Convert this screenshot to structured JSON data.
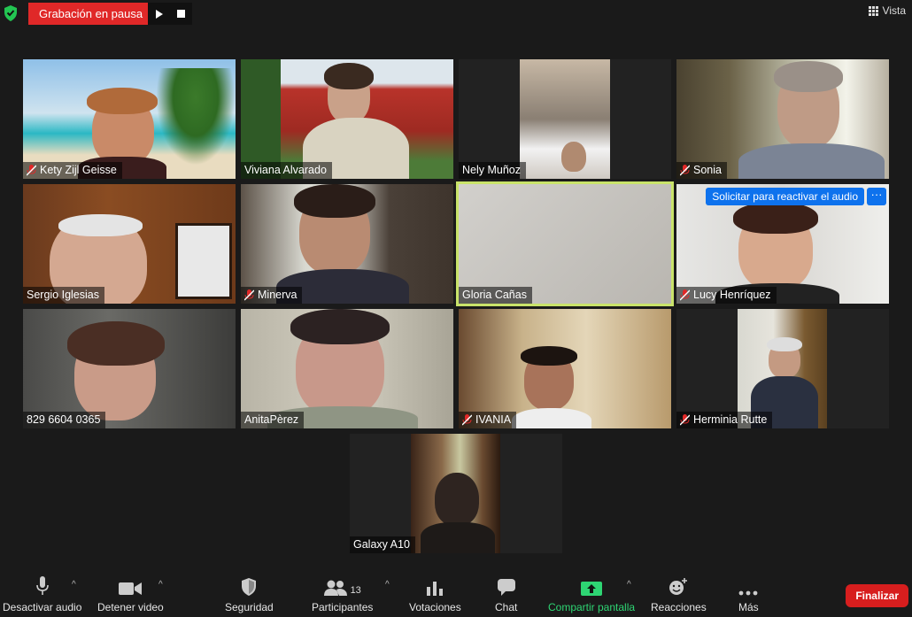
{
  "recording": {
    "status": "Grabación en pausa",
    "resume_icon": "play-icon",
    "stop_icon": "stop-icon"
  },
  "view": {
    "label": "Vista",
    "icon": "grid-icon"
  },
  "security_badge": {
    "icon": "shield-check-icon",
    "color": "#23c552"
  },
  "participants": [
    {
      "name": "Kety Zijl Geisse",
      "muted": true
    },
    {
      "name": "Viviana Alvarado",
      "muted": false
    },
    {
      "name": "Nely Muñoz",
      "muted": false
    },
    {
      "name": "Sonia",
      "muted": true
    },
    {
      "name": "Sergio Iglesias",
      "muted": false
    },
    {
      "name": "Minerva",
      "muted": true
    },
    {
      "name": "Gloria Cañas",
      "muted": false,
      "active_speaker": true
    },
    {
      "name": "Lucy Henríquez",
      "muted": true,
      "request_unmute": "Solicitar para reactivar el audio",
      "more": "···"
    },
    {
      "name": "829 6604 0365",
      "muted": false
    },
    {
      "name": "AnitaPèrez",
      "muted": false
    },
    {
      "name": "IVANIA",
      "muted": true
    },
    {
      "name": "Herminia Rutte",
      "muted": true
    },
    {
      "name": "Galaxy A10",
      "muted": false
    }
  ],
  "toolbar": {
    "mute": "Desactivar audio",
    "video": "Detener video",
    "security": "Seguridad",
    "participants": "Participantes",
    "participants_count": "13",
    "polls": "Votaciones",
    "chat": "Chat",
    "share": "Compartir pantalla",
    "reactions": "Reacciones",
    "more": "Más",
    "end": "Finalizar"
  },
  "colors": {
    "accent_blue": "#0e72ed",
    "end_red": "#d71e1e",
    "recording_red": "#e02828",
    "share_green": "#2ed573",
    "active_speaker_border": "#c9e36a",
    "mute_red": "#e02828"
  }
}
